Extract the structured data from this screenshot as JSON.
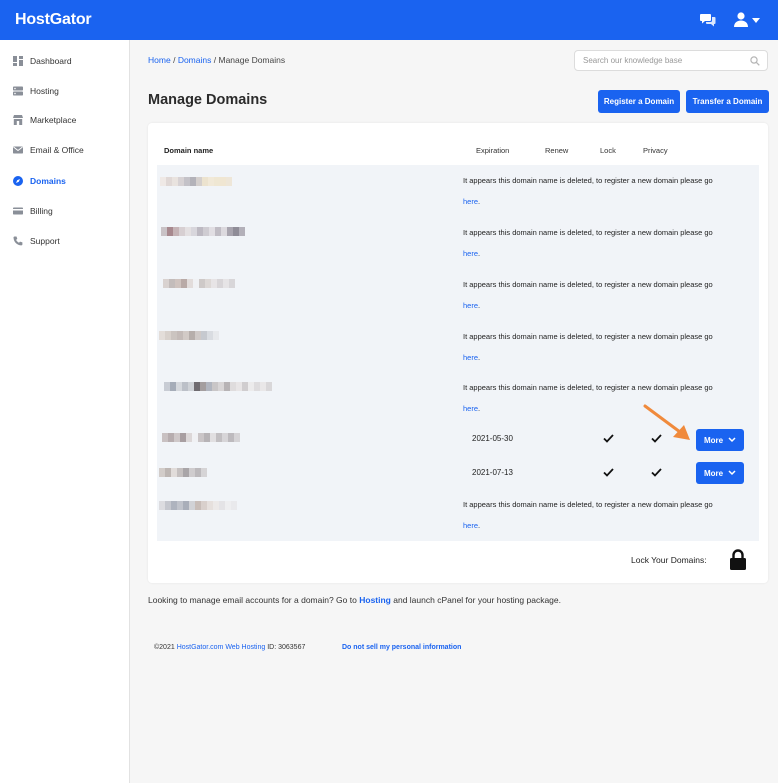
{
  "app": {
    "logo_text": "HostGator",
    "brand_color": "#1a63f0"
  },
  "topbar": {
    "icons": [
      "chat-icon",
      "user-icon",
      "caret-down-icon"
    ]
  },
  "sidebar": {
    "items": [
      {
        "label": "Dashboard",
        "icon": "dashboard-icon"
      },
      {
        "label": "Hosting",
        "icon": "server-icon"
      },
      {
        "label": "Marketplace",
        "icon": "store-icon"
      },
      {
        "label": "Email & Office",
        "icon": "mail-icon"
      },
      {
        "label": "Domains",
        "icon": "compass-icon",
        "active": true
      },
      {
        "label": "Billing",
        "icon": "credit-card-icon"
      },
      {
        "label": "Support",
        "icon": "phone-icon"
      }
    ]
  },
  "breadcrumb": {
    "home": "Home",
    "sep1": "/",
    "domains": "Domains",
    "sep2": "/",
    "current": "Manage Domains"
  },
  "search": {
    "placeholder": "Search our knowledge base"
  },
  "page": {
    "title": "Manage Domains"
  },
  "actions": {
    "register": "Register a Domain",
    "transfer": "Transfer a Domain"
  },
  "table": {
    "headers": {
      "domain": "Domain name",
      "expiration": "Expiration",
      "renew": "Renew",
      "lock": "Lock",
      "privacy": "Privacy"
    },
    "deleted_message": "It appears this domain name is deleted, to register a new domain please go",
    "link_text": "here",
    "period": ".",
    "rows": [
      {
        "status": "deleted"
      },
      {
        "status": "deleted"
      },
      {
        "status": "deleted"
      },
      {
        "status": "deleted"
      },
      {
        "status": "deleted"
      },
      {
        "status": "active",
        "expiration": "2021-05-30",
        "lock": true,
        "privacy": true,
        "action": "More"
      },
      {
        "status": "active",
        "expiration": "2021-07-13",
        "lock": true,
        "privacy": true,
        "action": "More"
      },
      {
        "status": "deleted"
      }
    ],
    "lock_all_label": "Lock Your Domains:"
  },
  "footer": {
    "note_pre": "Looking to manage email accounts for a domain? Go to",
    "note_link": "Hosting",
    "note_post": "and launch cPanel for your hosting package.",
    "copyright_pre": "©2021",
    "copyright_link": "HostGator.com Web Hosting",
    "copyright_id": "ID: 3063567",
    "privacy_link": "Do not sell my personal information"
  },
  "annotation": {
    "arrow_color": "#f08a3c"
  }
}
